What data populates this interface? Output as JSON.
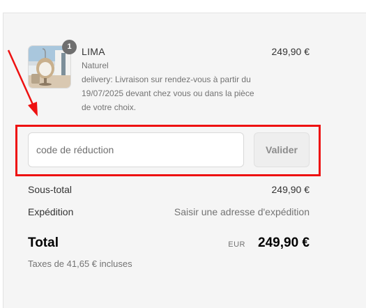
{
  "colors": {
    "panel_background": "#f5f5f5",
    "annotation_red": "#ee1111",
    "muted_text": "#737373",
    "badge": "#6f6f6f"
  },
  "product": {
    "image_icon": "product-photo-hanging-chair",
    "quantity": "1",
    "name": "LIMA",
    "variant": "Naturel",
    "delivery": "delivery: Livraison sur rendez-vous à partir du 19/07/2025 devant chez vous ou dans la pièce de votre choix.",
    "price": "249,90 €"
  },
  "discount": {
    "placeholder": "code de réduction",
    "value": "",
    "apply_label": "Valider"
  },
  "summary": {
    "subtotal_label": "Sous-total",
    "subtotal_value": "249,90 €",
    "shipping_label": "Expédition",
    "shipping_value": "Saisir une adresse d'expédition",
    "total_label": "Total",
    "currency": "EUR",
    "total_value": "249,90 €",
    "taxes_note": "Taxes de 41,65 € incluses"
  }
}
